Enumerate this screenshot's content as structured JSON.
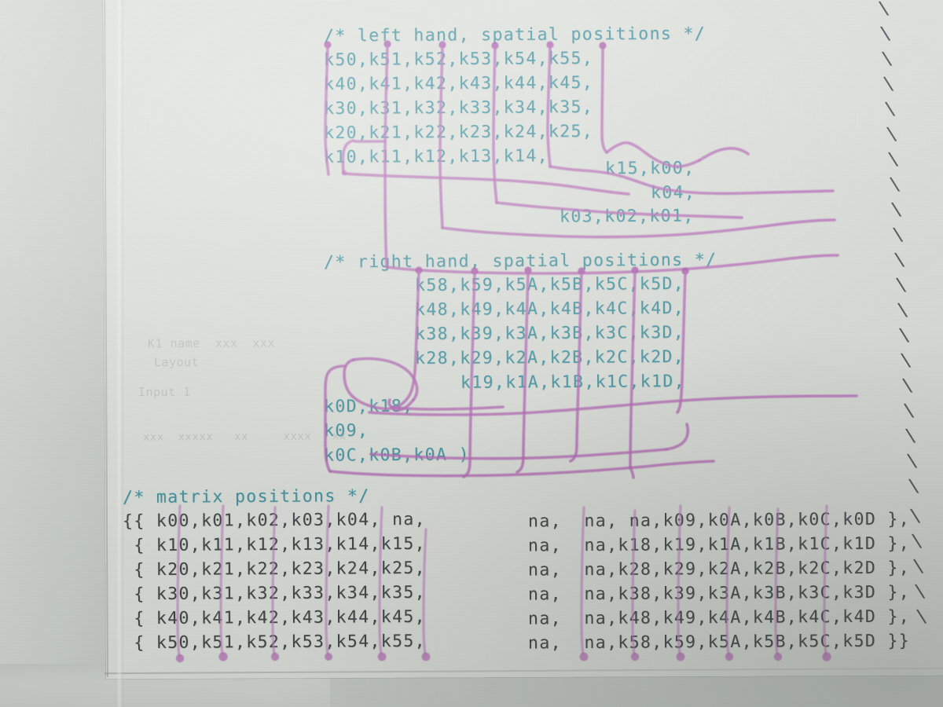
{
  "document": {
    "kind": "photo-of-printed-source-code",
    "subject": "keyboard firmware key matrix layout macro",
    "paper_color": "#e3e6e1",
    "background_color": "#cdd2cd",
    "comment_color": "#3f97a6",
    "code_color": "#3e4445",
    "pen_color": "#b667b8",
    "continuation_mark": "\\"
  },
  "left_hand_block": {
    "comment": "/* left hand, spatial positions */",
    "rows": [
      "k50,k51,k52,k53,k54,k55,",
      "k40,k41,k42,k43,k44,k45,",
      "k30,k31,k32,k33,k34,k35,",
      "k20,k21,k22,k23,k24,k25,",
      "k10,k11,k12,k13,k14,"
    ],
    "thumb_rows": [
      "k15,k00,",
      "k04,",
      "k03,k02,k01,"
    ]
  },
  "right_hand_block": {
    "comment": "/* right hand, spatial positions */",
    "rows": [
      "k58,k59,k5A,k5B,k5C,k5D,",
      "k48,k49,k4A,k4B,k4C,k4D,",
      "k38,k39,k3A,k3B,k3C,k3D,",
      "k28,k29,k2A,k2B,k2C,k2D,",
      "k19,k1A,k1B,k1C,k1D,"
    ],
    "thumb_rows": [
      "k0D,k18,",
      "k09,",
      "k0C,k0B,k0A )"
    ]
  },
  "matrix_block": {
    "comment": "/* matrix positions */",
    "rows": [
      "{{ k00,k01,k02,k03,k04, na,  na, na,k09,k0A,k0B,k0C,k0D },",
      " { k10,k11,k12,k13,k14,k15, na,  na,k18,k19,k1A,k1B,k1C,k1D },",
      " { k20,k21,k22,k23,k24,k25, na,  na,k28,k29,k2A,k2B,k2C,k2D },",
      " { k30,k31,k32,k33,k34,k35, na,  na,k38,k39,k3A,k3B,k3C,k3D },",
      " { k40,k41,k42,k43,k44,k45, na,  na,k48,k49,k4A,k4B,k4C,k4D },",
      " { k50,k51,k52,k53,k54,k55, na,  na,k58,k59,k5A,k5B,k5C,k5D }}"
    ],
    "rows_left": [
      "{{ k00,k01,k02,k03,k04, na, ",
      " { k10,k11,k12,k13,k14,k15, ",
      " { k20,k21,k22,k23,k24,k25, ",
      " { k30,k31,k32,k33,k34,k35, ",
      " { k40,k41,k42,k43,k44,k45, ",
      " { k50,k51,k52,k53,k54,k55, "
    ],
    "rows_right": [
      "na,  na, na,k09,k0A,k0B,k0C,k0D },",
      "na,  na,k18,k19,k1A,k1B,k1C,k1D },",
      "na,  na,k28,k29,k2A,k2B,k2C,k2D },",
      "na,  na,k38,k39,k3A,k3B,k3C,k3D },",
      "na,  na,k48,k49,k4A,k4B,k4C,k4D },",
      "na,  na,k58,k59,k5A,k5B,k5C,k5D }}"
    ]
  },
  "ghost_text": {
    "line1": "K1 name  xxx  xxx",
    "line2": "Layout",
    "line3": "Input 1",
    "line4": "xxx  xxxxx   xx     xxxx   xx"
  }
}
